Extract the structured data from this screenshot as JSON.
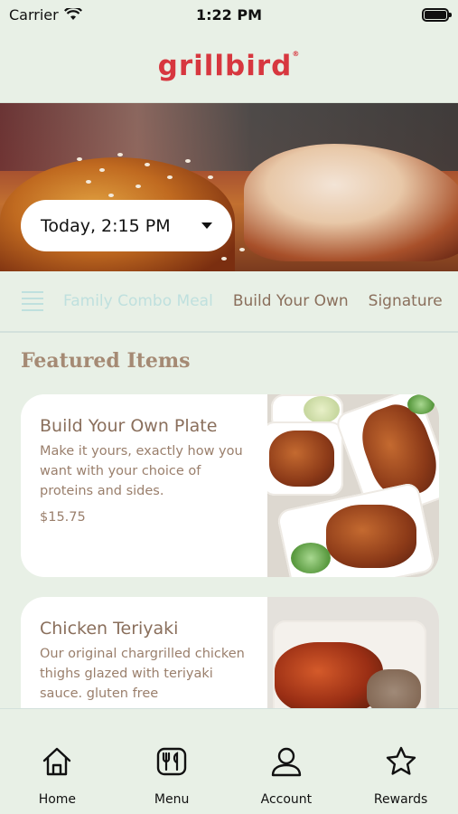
{
  "status_bar": {
    "carrier": "Carrier",
    "time": "1:22 PM",
    "battery_level": 1.0
  },
  "header": {
    "logo_text": "grillbird",
    "logo_mark": "®",
    "logo_color": "#d7373f"
  },
  "hero": {
    "pickup_time": "Today, 2:15 PM"
  },
  "tabs": [
    {
      "label": "Family Combo Meal",
      "active": true
    },
    {
      "label": "Build Your Own",
      "active": false
    },
    {
      "label": "Signature",
      "active": false
    }
  ],
  "featured": {
    "title": "Featured Items",
    "items": [
      {
        "name": "Build Your Own Plate",
        "description": "Make it yours, exactly how you want with your choice of proteins and sides.",
        "price": "$15.75"
      },
      {
        "name": "Chicken Teriyaki",
        "description": "Our original chargrilled chicken thighs glazed with teriyaki sauce. gluten free",
        "price": ""
      }
    ]
  },
  "bottom_nav": [
    {
      "label": "Home",
      "icon": "home-icon"
    },
    {
      "label": "Menu",
      "icon": "menu-icon"
    },
    {
      "label": "Account",
      "icon": "account-icon"
    },
    {
      "label": "Rewards",
      "icon": "star-icon"
    }
  ],
  "colors": {
    "background": "#e8f0e6",
    "accent": "#d7373f",
    "text_brown": "#8a6f5c",
    "active_tab": "#bfe0de"
  }
}
